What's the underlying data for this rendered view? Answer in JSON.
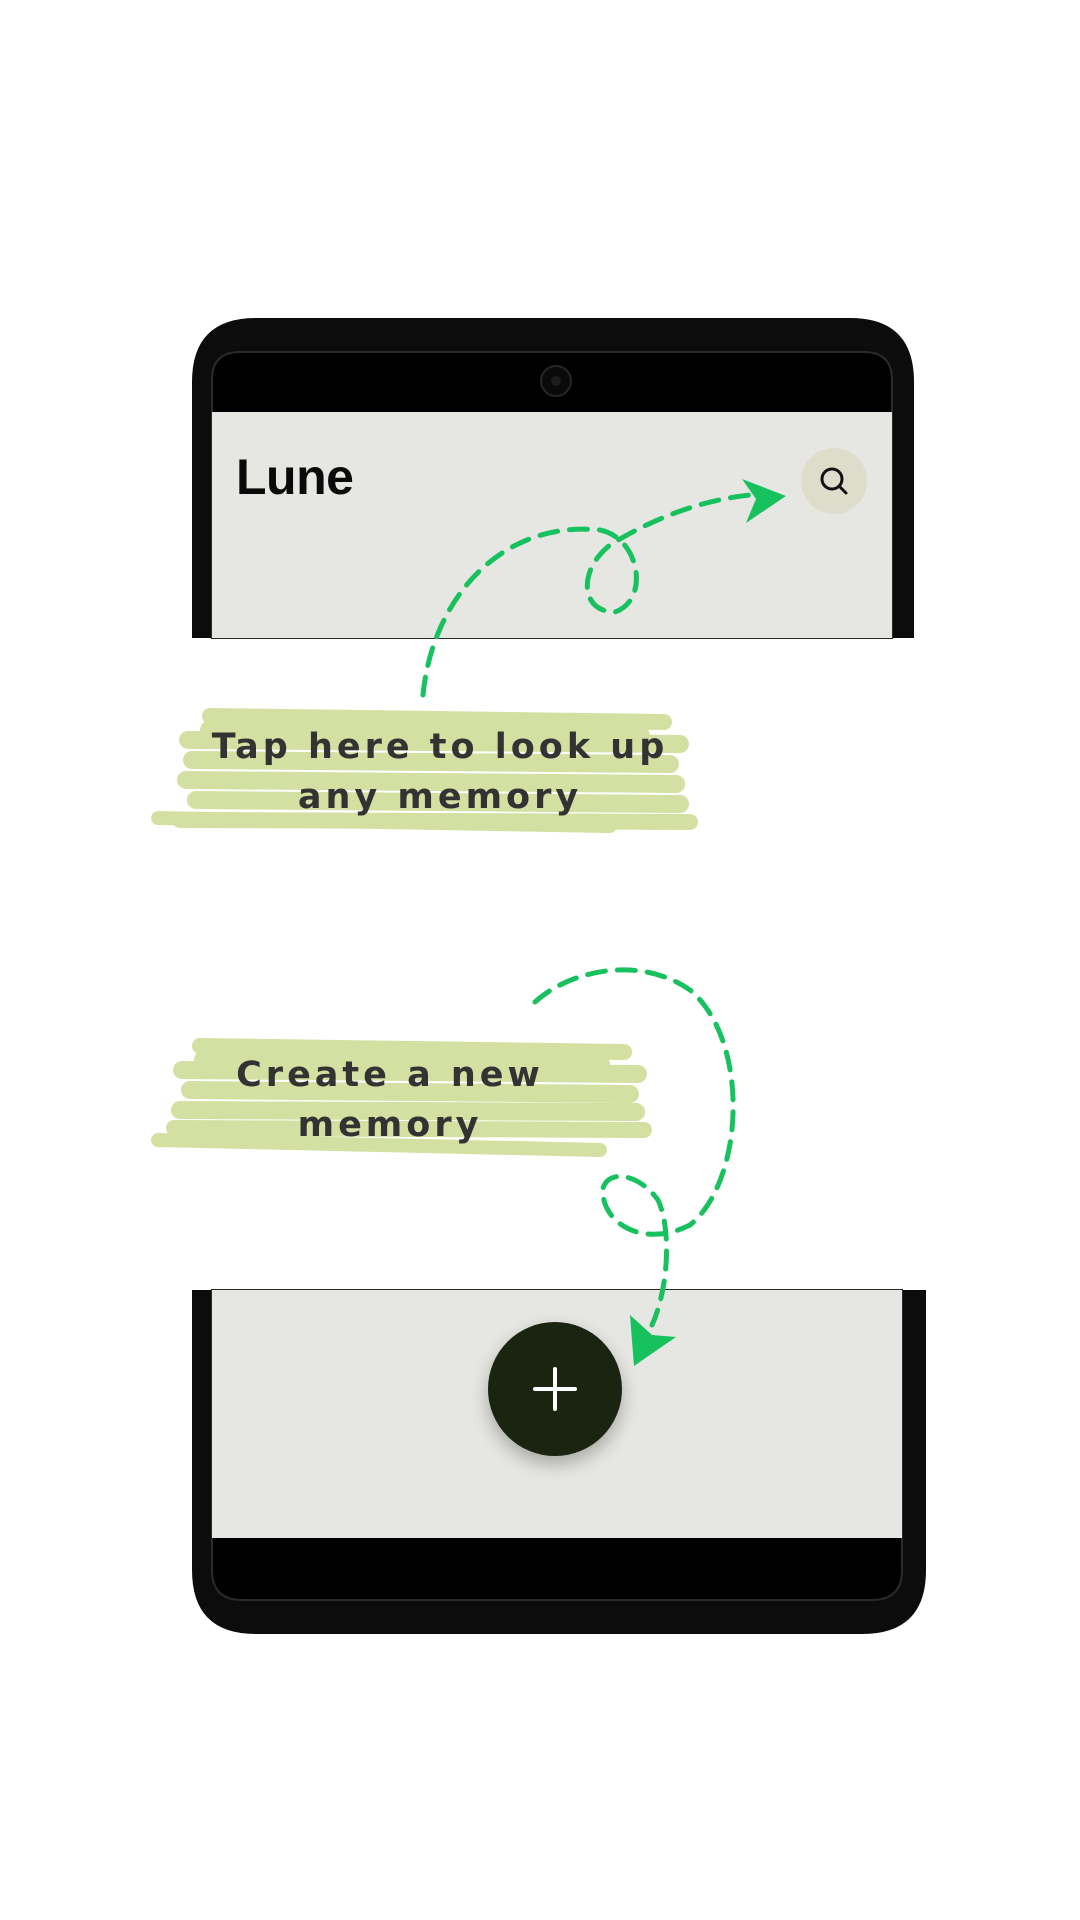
{
  "app": {
    "title": "Lune"
  },
  "header": {
    "search_icon": "search-icon"
  },
  "fab": {
    "icon": "plus-icon"
  },
  "callouts": {
    "search": {
      "line1": "Tap here to look up",
      "line2": "any memory"
    },
    "create": {
      "line1": "Create a new",
      "line2": "memory"
    }
  },
  "colors": {
    "screen_bg": "#e6e6e2",
    "search_button_bg": "#deddcc",
    "fab_bg": "#1b2410",
    "highlight": "#d3e0a2",
    "arrow": "#17c15d",
    "frame": "#000000"
  }
}
